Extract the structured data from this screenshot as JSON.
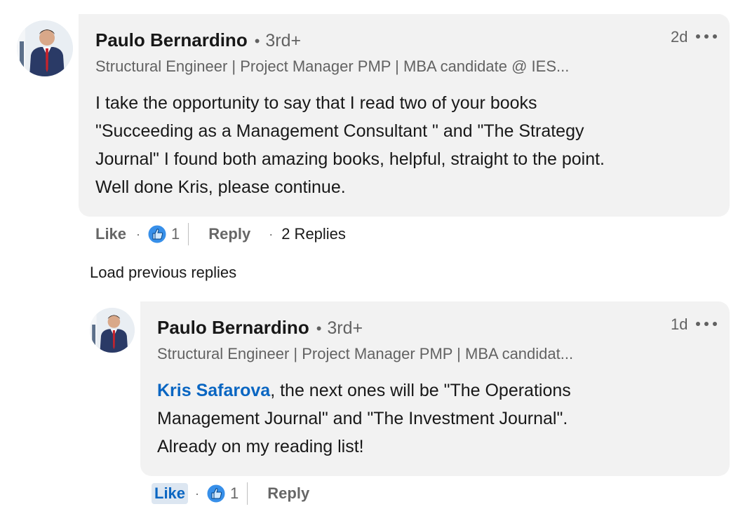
{
  "comment": {
    "author_name": "Paulo Bernardino",
    "degree": "3rd+",
    "headline": "Structural Engineer | Project Manager PMP | MBA candidate @ IES...",
    "timestamp": "2d",
    "body_lines": [
      "I take the opportunity to say that I read two of your books",
      "\"Succeeding as a Management Consultant \" and \"The Strategy",
      "Journal\" I found both amazing books, helpful, straight to the point.",
      "Well done Kris, please continue."
    ],
    "actions": {
      "like_label": "Like",
      "reaction_count": "1",
      "reply_label": "Reply",
      "replies_count_label": "2 Replies"
    }
  },
  "load_previous_label": "Load previous replies",
  "reply": {
    "author_name": "Paulo Bernardino",
    "degree": "3rd+",
    "headline": "Structural Engineer | Project Manager PMP | MBA candidat...",
    "timestamp": "1d",
    "mention": "Kris Safarova",
    "body_line1_rest": ", the next ones will be \"The Operations",
    "body_line2": "Management Journal\" and \"The Investment Journal\".",
    "body_line3": "Already on my reading list!",
    "actions": {
      "like_label": "Like",
      "like_active": true,
      "reaction_count": "1",
      "reply_label": "Reply"
    }
  },
  "icons": {
    "more": "more-horizontal-icon",
    "reaction": "like-reaction-icon"
  },
  "colors": {
    "bubble": "#f2f2f2",
    "link": "#0a66c2",
    "like_active_bg": "#dce6f1"
  }
}
